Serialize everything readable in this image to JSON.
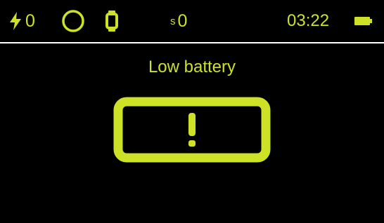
{
  "status": {
    "charge_count": "0",
    "steps_prefix": "s",
    "steps_count": "0",
    "time": "03:22"
  },
  "message": {
    "title": "Low battery"
  },
  "icons": {
    "charge": "lightning-bolt-icon",
    "activity_ring": "ring-icon",
    "watch": "watch-icon",
    "battery": "battery-icon",
    "warning": "empty-battery-warning-icon"
  },
  "colors": {
    "accent": "#cde127",
    "background": "#000000",
    "divider": "#ffffff"
  }
}
